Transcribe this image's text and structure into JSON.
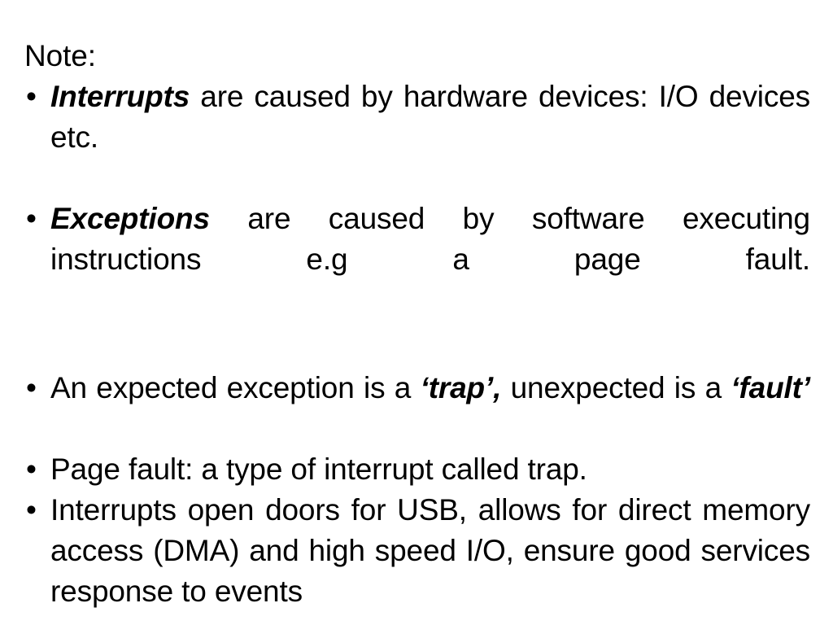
{
  "slide": {
    "background_color": "#ffffff",
    "text_color": "#000000",
    "bullet_glyph": "•",
    "heading": "Note:",
    "bullets": [
      {
        "id": "interrupts",
        "marker": "•",
        "lead_emphasis": "Interrupts",
        "rest": " are caused by hardware devices: I/O devices etc.",
        "full_text": "Interrupts are caused by hardware devices: I/O devices etc."
      },
      {
        "id": "exceptions",
        "marker": "•",
        "lead_emphasis": "Exceptions",
        "rest": " are caused by software executing instructions e.g a page fault.",
        "full_text": "Exceptions are caused by software executing instructions e.g a page fault."
      },
      {
        "id": "trap-fault",
        "marker": "•",
        "prefix": "An expected exception is a ",
        "emphasis_1": "‘trap’,",
        "middle": " unexpected is a ",
        "emphasis_2": "‘fault’",
        "full_text": "An expected exception is a ‘trap’, unexpected is a ‘fault’"
      },
      {
        "id": "page-fault",
        "marker": "•",
        "full_text": "Page fault: a type of interrupt called trap."
      },
      {
        "id": "interrupts-usb",
        "marker": "•",
        "full_text": "Interrupts open doors for USB, allows for direct memory access (DMA) and high speed I/O, ensure good services response to events"
      }
    ]
  }
}
